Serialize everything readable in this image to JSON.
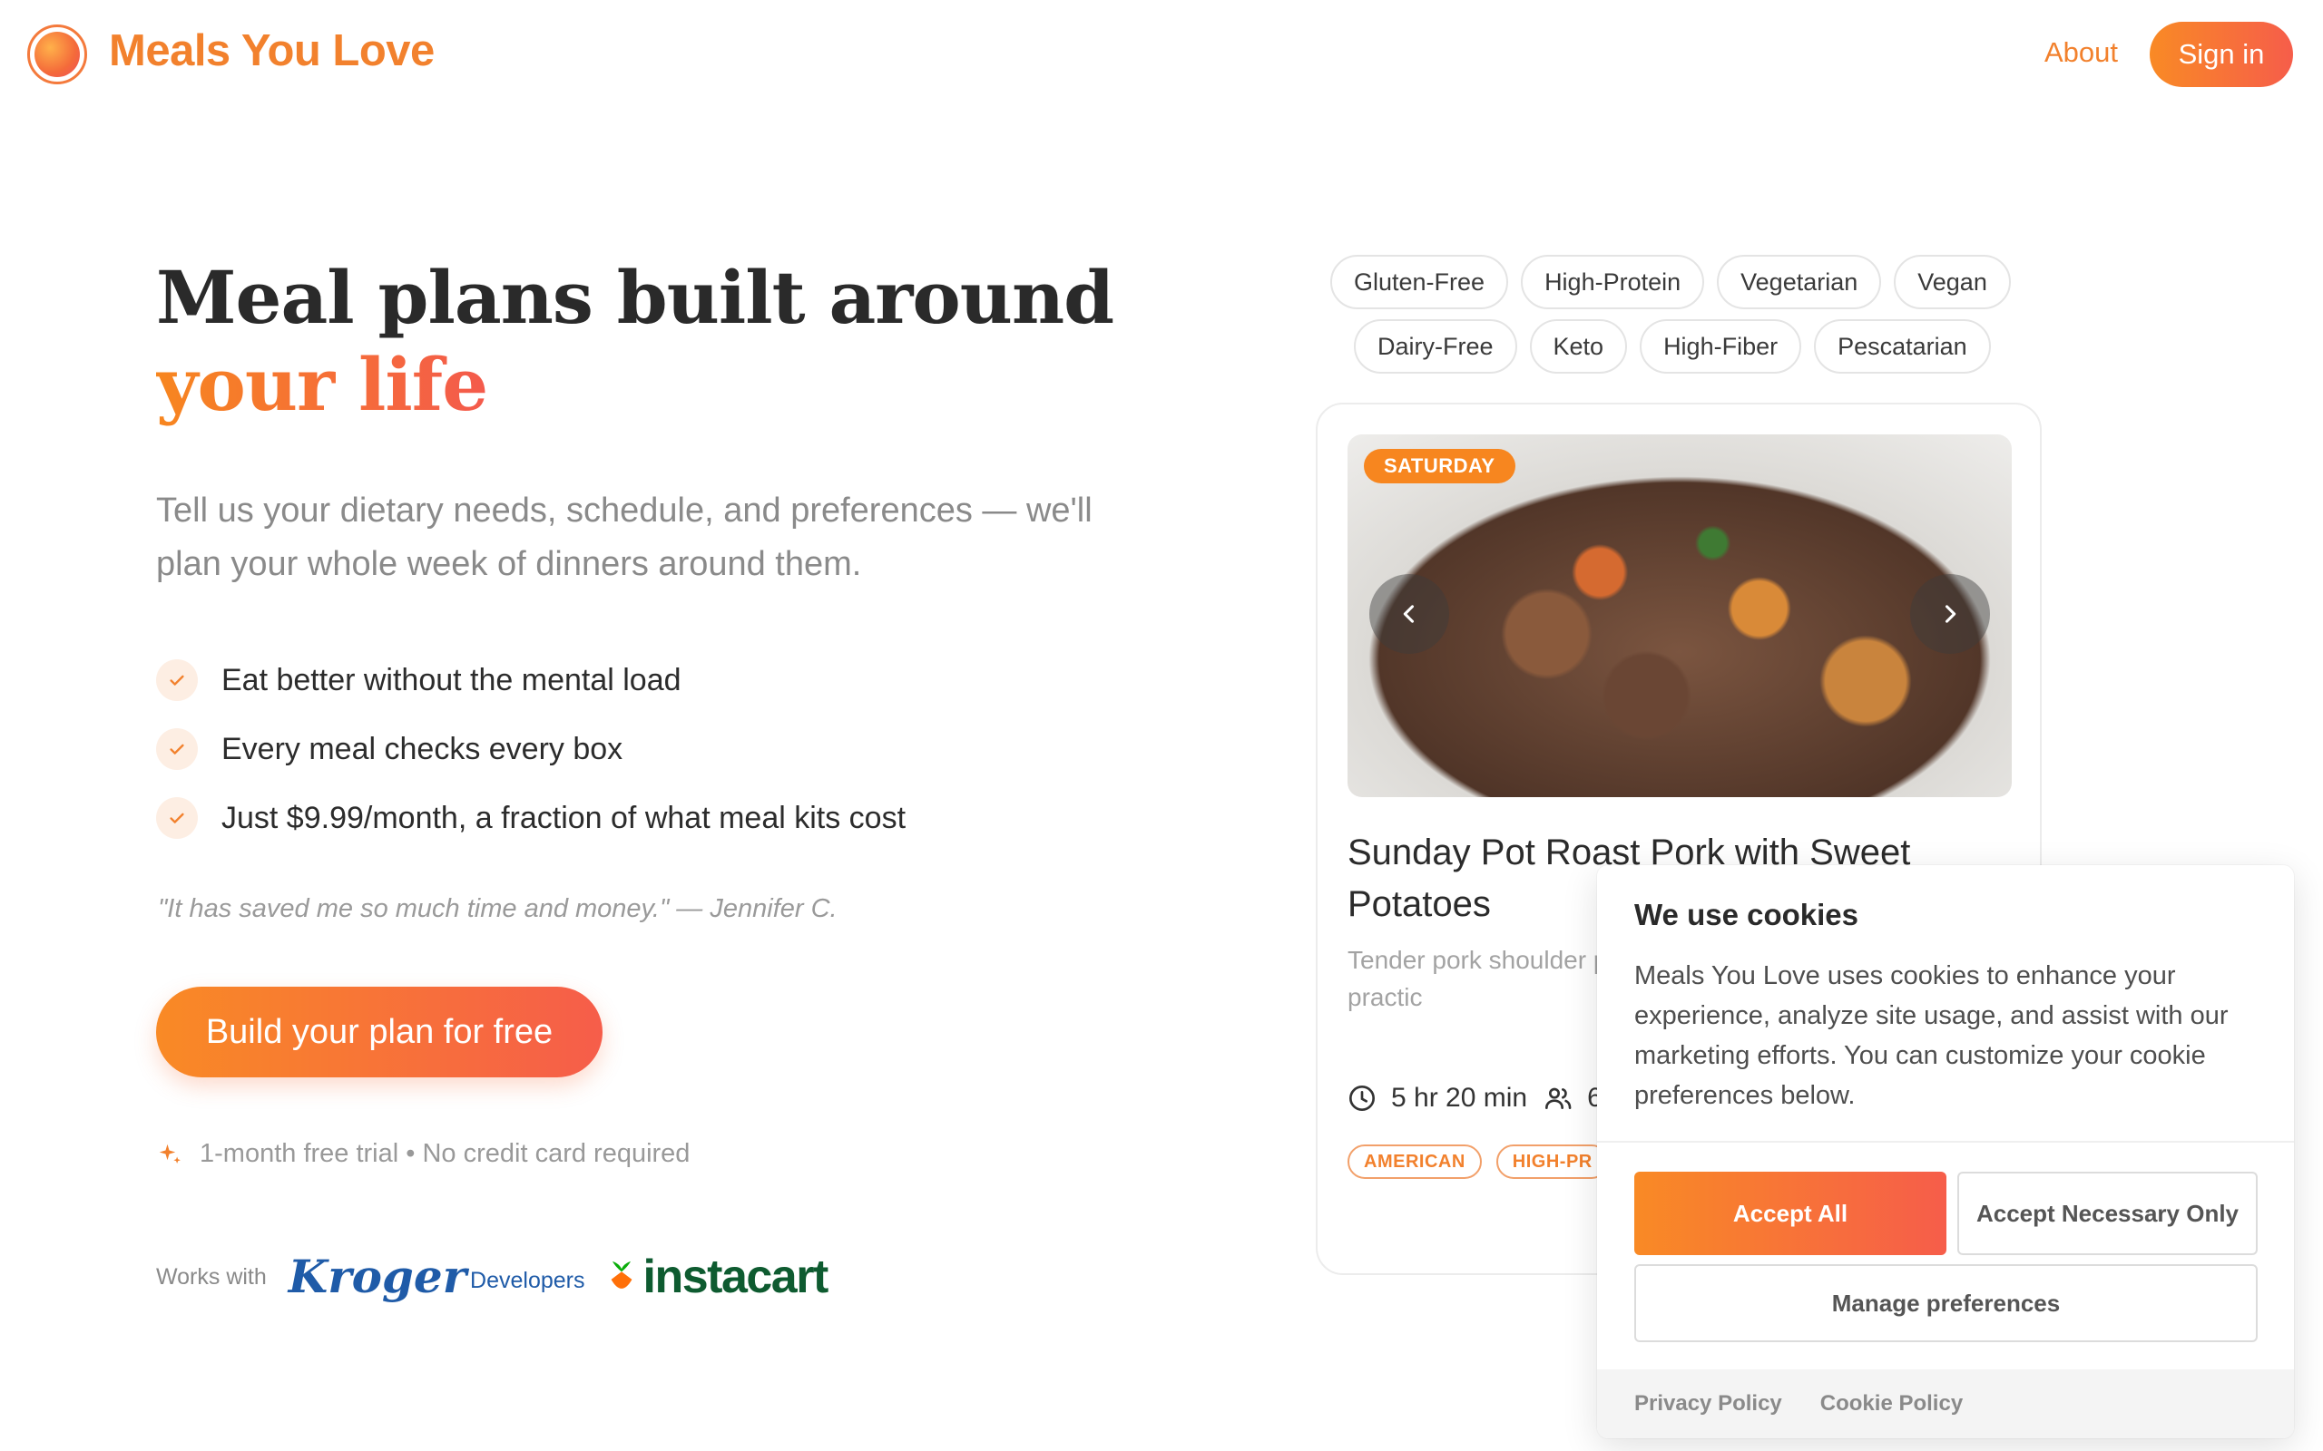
{
  "header": {
    "brand": "Meals You Love",
    "about_label": "About",
    "signin_label": "Sign in"
  },
  "hero": {
    "title_line1": "Meal plans built around",
    "title_line2": "your life",
    "subtitle": "Tell us your dietary needs, schedule, and preferences — we'll plan your whole week of dinners around them.",
    "benefits": [
      "Eat better without the mental load",
      "Every meal checks every box",
      "Just $9.99/month, a fraction of what meal kits cost"
    ],
    "quote": "\"It has saved me so much time and money.\" — Jennifer C.",
    "cta_label": "Build your plan for free",
    "trial_note": "1-month free trial • No credit card required",
    "works_with_label": "Works with",
    "partners": {
      "kroger": "Kroger",
      "kroger_suffix": "Developers",
      "instacart": "instacart"
    }
  },
  "diet_tags": {
    "row1": [
      "Gluten-Free",
      "High-Protein",
      "Vegetarian",
      "Vegan"
    ],
    "row2": [
      "Dairy-Free",
      "Keto",
      "High-Fiber",
      "Pescatarian"
    ]
  },
  "meal_card": {
    "day": "SATURDAY",
    "title": "Sunday Pot Roast Pork with Sweet Potatoes",
    "description": "Tender pork shoulder potatoes, carrots, an comfort meal practic",
    "cook_time": "5 hr 20 min",
    "servings": "6",
    "cuisine_tags": [
      "AMERICAN",
      "HIGH-PR"
    ],
    "icons": {
      "prev": "chevron-left-icon",
      "next": "chevron-right-icon",
      "time": "clock-icon",
      "servings": "people-icon"
    }
  },
  "cookie_banner": {
    "title": "We use cookies",
    "body": "Meals You Love uses cookies to enhance your experience, analyze site usage, and assist with our marketing efforts. You can customize your cookie preferences below.",
    "accept_all": "Accept All",
    "accept_necessary": "Accept Necessary Only",
    "manage": "Manage preferences",
    "privacy_link": "Privacy Policy",
    "cookie_link": "Cookie Policy"
  },
  "colors": {
    "accent": "#f2812d",
    "gradient_start": "#f98a25",
    "gradient_end": "#f65d4a",
    "instacart_green": "#0e5b30",
    "kroger_blue": "#1f5ba8"
  }
}
